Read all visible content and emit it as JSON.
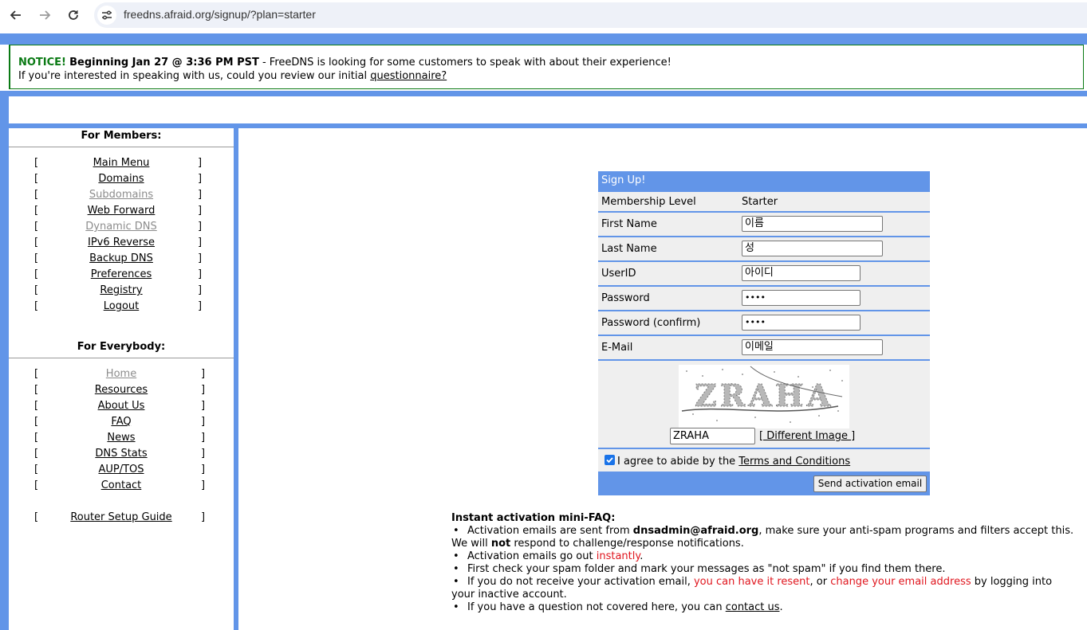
{
  "browser": {
    "url": "freedns.afraid.org/signup/?plan=starter",
    "icons": [
      "back-arrow-icon",
      "forward-arrow-icon",
      "reload-icon",
      "site-info-icon"
    ]
  },
  "notice": {
    "tag": "NOTICE!",
    "headline": "Beginning Jan 27 @ 3:36 PM PST",
    "text": " - FreeDNS is looking for some customers to speak with about their experience!",
    "line2_text": "If you're interested in speaking with us, could you review our initial ",
    "line2_link": "questionnaire?"
  },
  "sidebar": {
    "members_title": "For Members:",
    "members_items": [
      {
        "label": "Main Menu",
        "dim": false
      },
      {
        "label": "Domains",
        "dim": false
      },
      {
        "label": "Subdomains",
        "dim": true
      },
      {
        "label": "Web Forward",
        "dim": false
      },
      {
        "label": "Dynamic DNS",
        "dim": true
      },
      {
        "label": "IPv6 Reverse",
        "dim": false
      },
      {
        "label": "Backup DNS",
        "dim": false
      },
      {
        "label": "Preferences",
        "dim": false
      },
      {
        "label": "Registry",
        "dim": false
      },
      {
        "label": "Logout",
        "dim": false
      }
    ],
    "everybody_title": "For Everybody:",
    "everybody_items": [
      {
        "label": "Home",
        "dim": true
      },
      {
        "label": "Resources",
        "dim": false
      },
      {
        "label": "About Us",
        "dim": false
      },
      {
        "label": "FAQ",
        "dim": false
      },
      {
        "label": "News",
        "dim": false
      },
      {
        "label": "DNS Stats",
        "dim": false
      },
      {
        "label": "AUP/TOS",
        "dim": false
      },
      {
        "label": "Contact",
        "dim": false
      }
    ],
    "router_guide": "Router Setup Guide",
    "bracket_open": "[",
    "bracket_close": "]"
  },
  "form": {
    "title": "Sign Up!",
    "membership_label": "Membership Level",
    "membership_value": "Starter",
    "first_name_label": "First Name",
    "first_name_value": "이름",
    "last_name_label": "Last Name",
    "last_name_value": "성",
    "userid_label": "UserID",
    "userid_value": "아이디",
    "password_label": "Password",
    "password_value": "••••",
    "password_confirm_label": "Password (confirm)",
    "password_confirm_value": "••••",
    "email_label": "E-Mail",
    "email_value": "이메일",
    "captcha_text": "ZRAHA",
    "captcha_value": "ZRAHA",
    "different_image": "[ Different Image ]",
    "agree_text": "I agree to abide by the ",
    "terms_link": "Terms and Conditions",
    "agree_checked": true,
    "send_button": "Send activation email"
  },
  "faq": {
    "title": "Instant activation mini-FAQ:",
    "b1_a": "Activation emails are sent from ",
    "b1_email": "dnsadmin@afraid.org",
    "b1_b": ", make sure your anti-spam programs and filters accept this.",
    "b1_c": "We will ",
    "b1_not": "not",
    "b1_d": " respond to challenge/response notifications.",
    "b2_a": "Activation emails go out ",
    "b2_red": "instantly",
    "b2_b": ".",
    "b3": "First check your spam folder and mark your messages as \"not spam\" if you find them there.",
    "b4_a": "If you do not receive your activation email, ",
    "b4_red1": "you can have it resent",
    "b4_b": ", or ",
    "b4_red2": "change your email address",
    "b4_c": " by logging into",
    "b4_d": "your inactive account.",
    "b5_a": "If you have a question not covered here, you can ",
    "b5_link": "contact us",
    "b5_b": "."
  },
  "colors": {
    "frame_blue": "#6295e8",
    "notice_green": "#0a7a14",
    "link_red": "#e0161e",
    "row_gray": "#efefef"
  }
}
